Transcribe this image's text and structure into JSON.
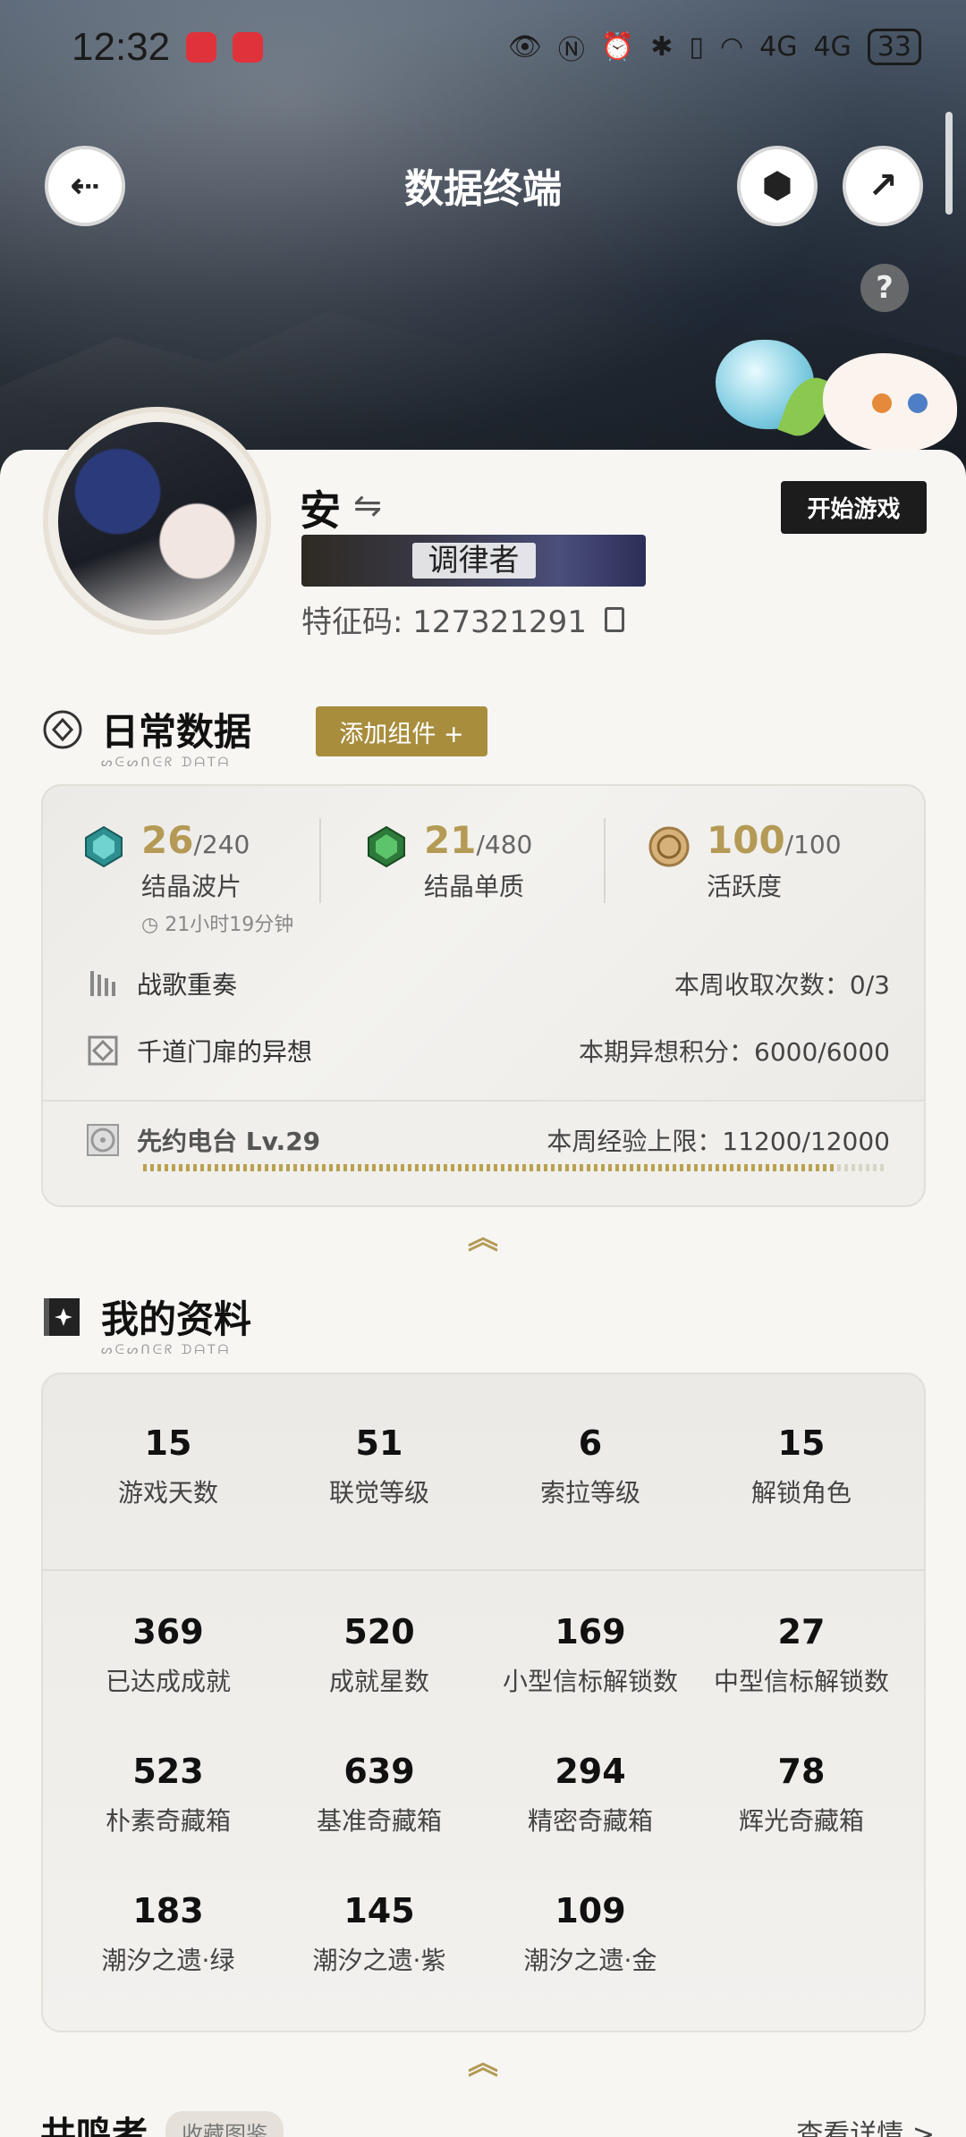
{
  "status_bar": {
    "time": "12:32",
    "network_1": "4G",
    "network_2": "4G",
    "battery": "33"
  },
  "header": {
    "title": "数据终端"
  },
  "profile": {
    "name": "安",
    "title_badge": "调律者",
    "uid_label": "特征码: 127321291",
    "start_button": "开始游戏"
  },
  "daily": {
    "title": "日常数据",
    "subtitle": "ᔕᕮᔕᑎᕮᖇ ᗪᗩTᗩ",
    "add_widget": "添加组件 +",
    "stats": [
      {
        "current": "26",
        "max": "/240",
        "label": "结晶波片",
        "timer": "21小时19分钟"
      },
      {
        "current": "21",
        "max": "/480",
        "label": "结晶单质"
      },
      {
        "current": "100",
        "max": "/100",
        "label": "活跃度"
      }
    ],
    "rows": [
      {
        "label": "战歌重奏",
        "value": "本周收取次数：0/3"
      },
      {
        "label": "千道门扉的异想",
        "value": "本期异想积分：6000/6000"
      }
    ],
    "radio": {
      "label": "先约电台 Lv.29",
      "value": "本周经验上限：11200/12000",
      "progress": 0.933
    }
  },
  "my_profile": {
    "title": "我的资料",
    "subtitle": "ᔕᕮᔕᑎᕮᖇ ᗪᗩTᗩ",
    "stats": [
      {
        "value": "15",
        "label": "游戏天数"
      },
      {
        "value": "51",
        "label": "联觉等级"
      },
      {
        "value": "6",
        "label": "索拉等级"
      },
      {
        "value": "15",
        "label": "解锁角色"
      },
      {
        "value": "369",
        "label": "已达成成就"
      },
      {
        "value": "520",
        "label": "成就星数"
      },
      {
        "value": "169",
        "label": "小型信标解锁数"
      },
      {
        "value": "27",
        "label": "中型信标解锁数"
      },
      {
        "value": "523",
        "label": "朴素奇藏箱"
      },
      {
        "value": "639",
        "label": "基准奇藏箱"
      },
      {
        "value": "294",
        "label": "精密奇藏箱"
      },
      {
        "value": "78",
        "label": "辉光奇藏箱"
      },
      {
        "value": "183",
        "label": "潮汐之遗·绿"
      },
      {
        "value": "145",
        "label": "潮汐之遗·紫"
      },
      {
        "value": "109",
        "label": "潮汐之遗·金"
      }
    ]
  },
  "resonators": {
    "title": "共鸣者",
    "tag": "收藏图鉴",
    "link": "查看详情 >"
  },
  "colors": {
    "accent_gold": "#b49a55",
    "button_gold": "#a88d3d",
    "dark_button": "#1c1c1c"
  }
}
